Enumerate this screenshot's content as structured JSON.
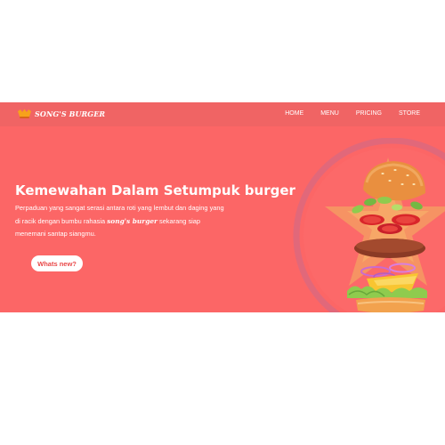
{
  "navbar": {
    "brand": "SONG'S BURGER",
    "links": [
      "HOME",
      "MENU",
      "PRICING",
      "STORE"
    ]
  },
  "hero": {
    "title": "Kemewahan Dalam Setumpuk burger",
    "description_part1": "Perpaduan yang sangat serasi antara roti yang lembut dan daging yang di racik dengan bumbu rahasia ",
    "description_brand": "song's burger",
    "description_part2": " sekarang siap menemani santap siangmu.",
    "cta_label": "Whats new?"
  },
  "colors": {
    "background": "#fc6666",
    "navbar": "#f06464",
    "text": "#ffffff",
    "button_text": "#e94848"
  },
  "icons": {
    "logo": "burger-logo-icon",
    "illustration": "exploded-burger-illustration"
  }
}
